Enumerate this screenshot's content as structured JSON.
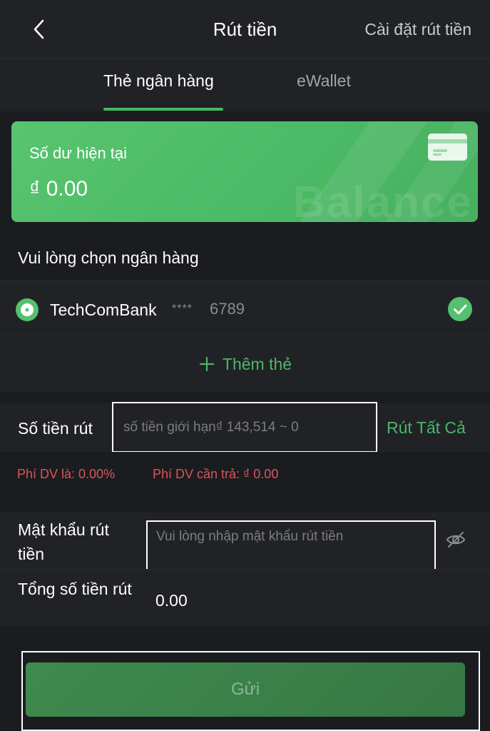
{
  "header": {
    "title": "Rút tiền",
    "settings_link": "Cài đặt rút tiền"
  },
  "tabs": [
    {
      "label": "Thẻ ngân hàng",
      "active": true
    },
    {
      "label": "eWallet",
      "active": false
    }
  ],
  "balance": {
    "label": "Số dư hiện tại",
    "value": "₫ 0.00",
    "watermark": "Balance"
  },
  "bank_section": {
    "label": "Vui lòng chọn ngân hàng",
    "bank_name": "TechComBank",
    "mask": "****",
    "last_digits": "6789",
    "add_card_label": "Thêm thẻ"
  },
  "amount": {
    "label": "Số tiền rút",
    "value": "",
    "placeholder": "số tiền giới hạn₫ 143,514 ~ 0",
    "withdraw_all_label": "Rút Tất Cả"
  },
  "fees": {
    "rate": "Phí DV là: 0.00%",
    "due": "Phí DV cần trả: ₫ 0.00"
  },
  "password": {
    "label": "Mật khẩu rút tiền",
    "value": "",
    "placeholder": "Vui lòng nhập mật khẩu rút tiền"
  },
  "total": {
    "label": "Tổng số tiền rút",
    "value": "0.00"
  },
  "submit": {
    "label": "Gửi"
  },
  "colors": {
    "accent_green": "#49b866",
    "card_green": "#52bf6b",
    "fee_red": "#d9545b",
    "background": "#1b1c20",
    "panel": "#212226"
  },
  "icons": [
    "back-icon",
    "card-icon",
    "bank-logo-icon",
    "check-icon",
    "plus-icon",
    "eye-off-icon"
  ]
}
